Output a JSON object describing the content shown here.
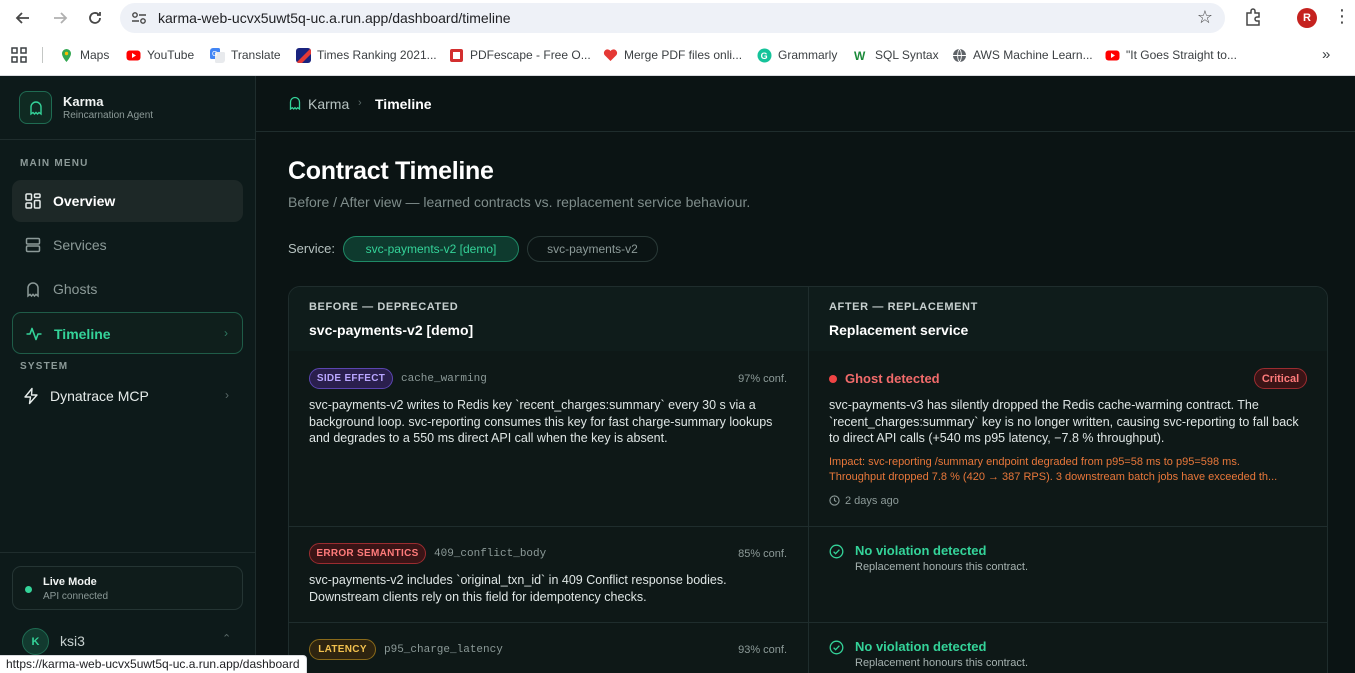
{
  "browser": {
    "url": "karma-web-ucvx5uwt5q-uc.a.run.app/dashboard/timeline",
    "avatar_letter": "R",
    "status_url": "https://karma-web-ucvx5uwt5q-uc.a.run.app/dashboard",
    "bookmarks": [
      {
        "label": "Maps",
        "icon": "maps-icon",
        "color": "#34a853"
      },
      {
        "label": "YouTube",
        "icon": "youtube-icon",
        "color": "#ff0000"
      },
      {
        "label": "Translate",
        "icon": "translate-icon",
        "color": "#4285f4"
      },
      {
        "label": "Times Ranking 2021...",
        "icon": "times-icon",
        "color": "#1a237e"
      },
      {
        "label": "PDFescape - Free O...",
        "icon": "pdf-icon",
        "color": "#d32f2f"
      },
      {
        "label": "Merge PDF files onli...",
        "icon": "heart-icon",
        "color": "#e53935"
      },
      {
        "label": "Grammarly",
        "icon": "grammarly-icon",
        "color": "#15c39a"
      },
      {
        "label": "SQL Syntax",
        "icon": "w-icon",
        "color": "#1b8a3a"
      },
      {
        "label": "AWS Machine Learn...",
        "icon": "globe-icon",
        "color": "#5f6368"
      },
      {
        "label": "\"It Goes Straight to...",
        "icon": "youtube-icon",
        "color": "#ff0000"
      }
    ]
  },
  "sidebar": {
    "brand_name": "Karma",
    "brand_sub": "Reincarnation Agent",
    "main_menu_label": "MAIN MENU",
    "system_label": "SYSTEM",
    "items": {
      "overview": "Overview",
      "services": "Services",
      "ghosts": "Ghosts",
      "timeline": "Timeline",
      "dynatrace": "Dynatrace MCP"
    },
    "live_title": "Live Mode",
    "live_sub": "API connected",
    "user_initial": "K",
    "user_name": "ksi3"
  },
  "header": {
    "crumb_root": "Karma",
    "crumb_current": "Timeline"
  },
  "main": {
    "title": "Contract Timeline",
    "subtitle": "Before / After view — learned contracts vs. replacement service behaviour.",
    "service_label": "Service:",
    "services": [
      "svc-payments-v2 [demo]",
      "svc-payments-v2"
    ],
    "before_kicker": "BEFORE — DEPRECATED",
    "before_title": "svc-payments-v2 [demo]",
    "after_kicker": "AFTER — REPLACEMENT",
    "after_title": "Replacement service",
    "rows": [
      {
        "badge": "SIDE EFFECT",
        "key": "cache_warming",
        "conf": "97% conf.",
        "text": "svc-payments-v2 writes to Redis key `recent_charges:summary` every 30 s via a background loop. svc-reporting consumes this key for fast charge-summary lookups and degrades to a 550 ms direct API call when the key is absent.",
        "after_status": "Ghost detected",
        "severity": "Critical",
        "after_text": "svc-payments-v3 has silently dropped the Redis cache-warming contract. The `recent_charges:summary` key is no longer written, causing svc-reporting to fall back to direct API calls (+540 ms p95 latency, −7.8 % throughput).",
        "impact_1": "Impact: svc-reporting /summary endpoint degraded from p95=58 ms to p95=598 ms.",
        "impact_2": "Throughput dropped 7.8 % (420 → 387 RPS). 3 downstream batch jobs have exceeded th...",
        "ago": "2 days ago"
      },
      {
        "badge": "ERROR SEMANTICS",
        "key": "409_conflict_body",
        "conf": "85% conf.",
        "text": "svc-payments-v2 includes `original_txn_id` in 409 Conflict response bodies. Downstream clients rely on this field for idempotency checks.",
        "after_status": "No violation detected",
        "after_text": "Replacement honours this contract."
      },
      {
        "badge": "LATENCY",
        "key": "p95_charge_latency",
        "conf": "93% conf.",
        "after_status": "No violation detected",
        "after_text": "Replacement honours this contract."
      }
    ]
  }
}
